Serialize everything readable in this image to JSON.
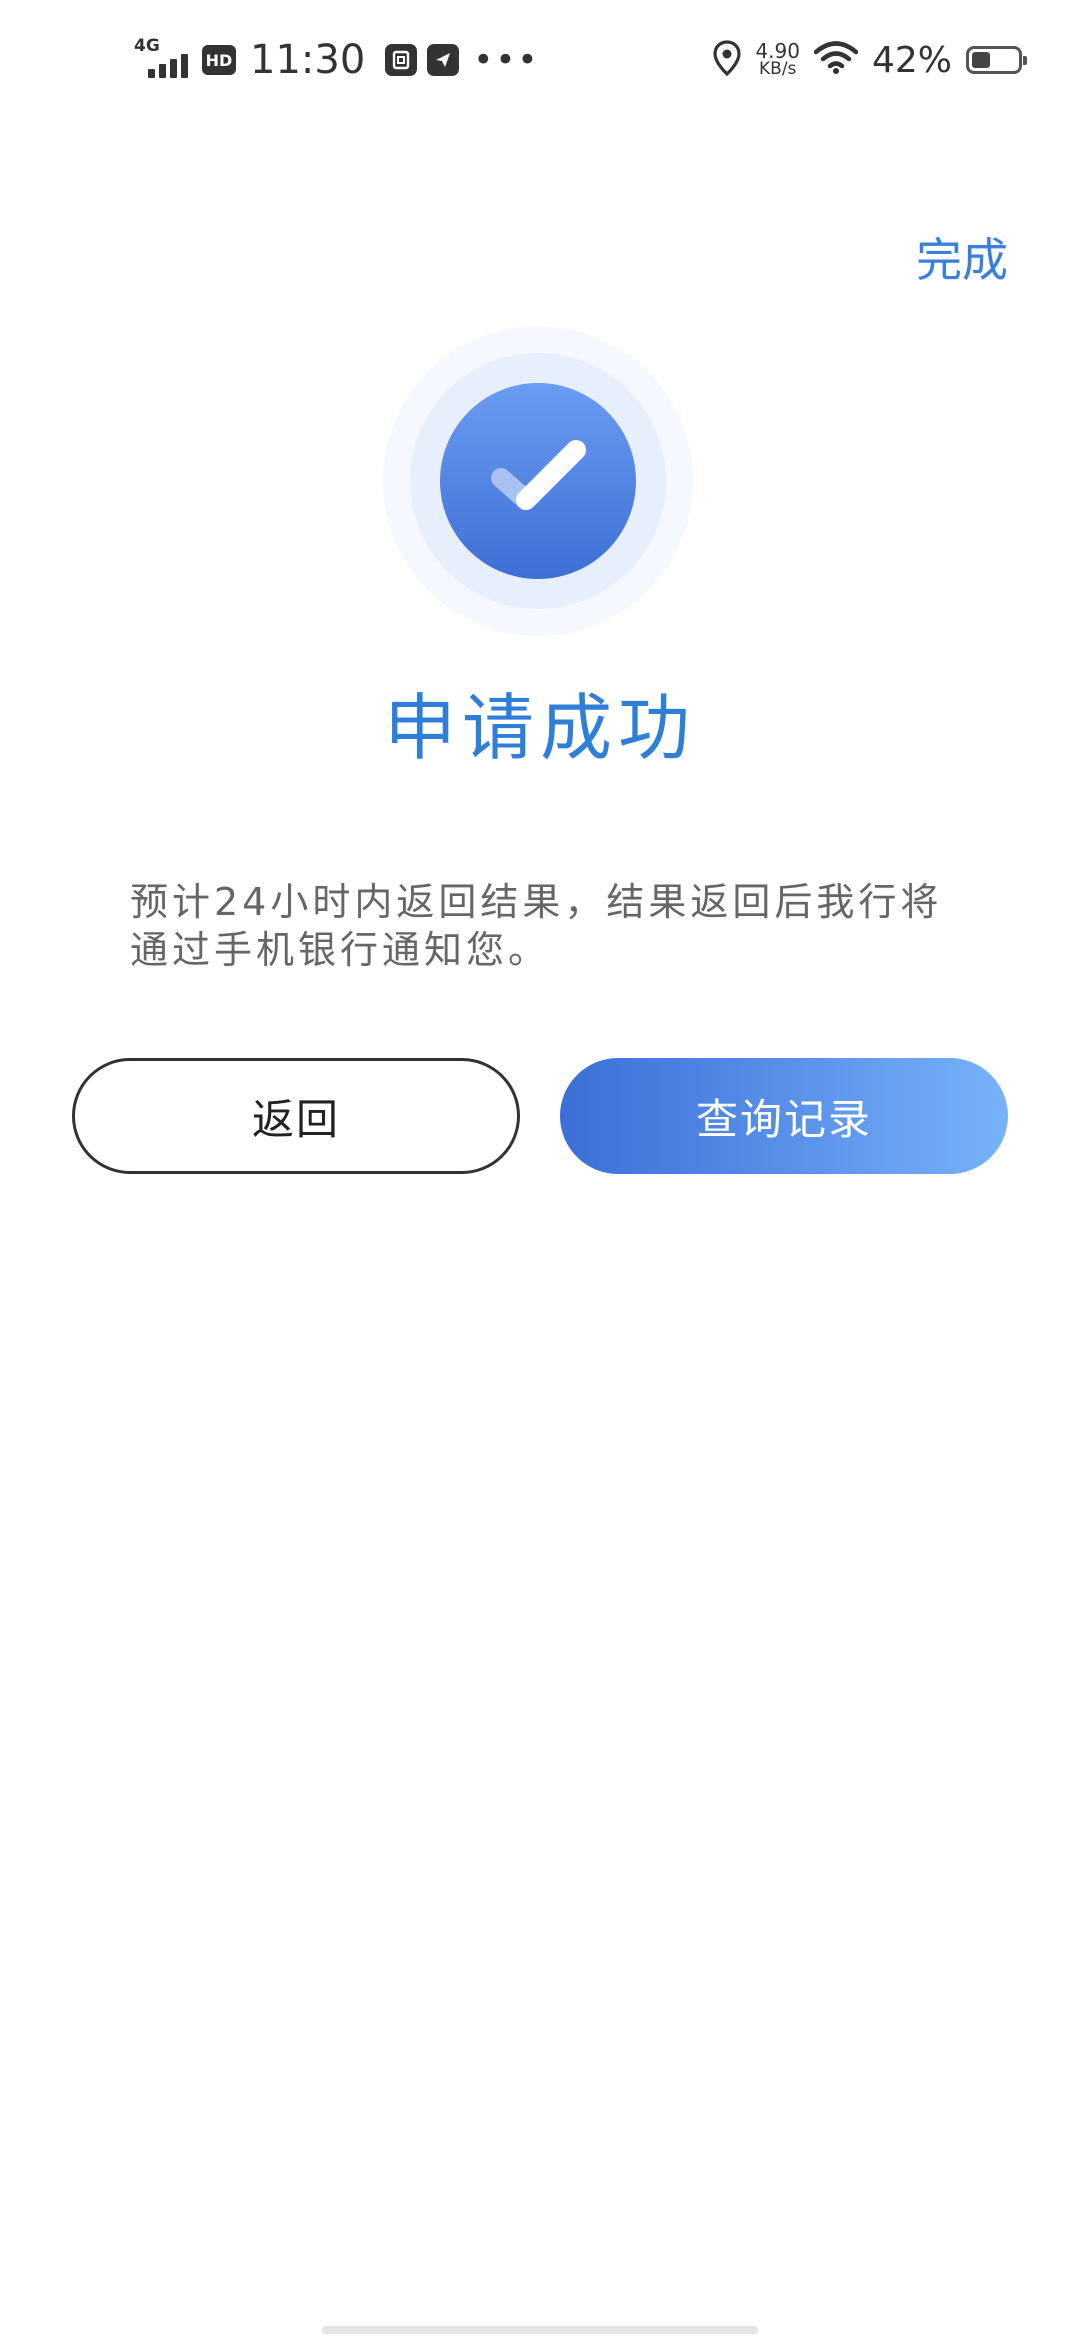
{
  "status_bar": {
    "network": "4G",
    "hd": "HD",
    "time": "11:30",
    "more": "•••",
    "speed_value": "4.90",
    "speed_unit": "KB/s",
    "battery_percent": "42%",
    "battery_level": 0.42
  },
  "header": {
    "done_label": "完成"
  },
  "result": {
    "title": "申请成功",
    "description": "预计24小时内返回结果，结果返回后我行将通过手机银行通知您。"
  },
  "actions": {
    "back_label": "返回",
    "query_label": "查询记录"
  },
  "colors": {
    "accent": "#2f7fd8",
    "button_gradient_start": "#3b6fd8",
    "button_gradient_end": "#77b3f8",
    "icon_fill": "#4f82e6"
  }
}
